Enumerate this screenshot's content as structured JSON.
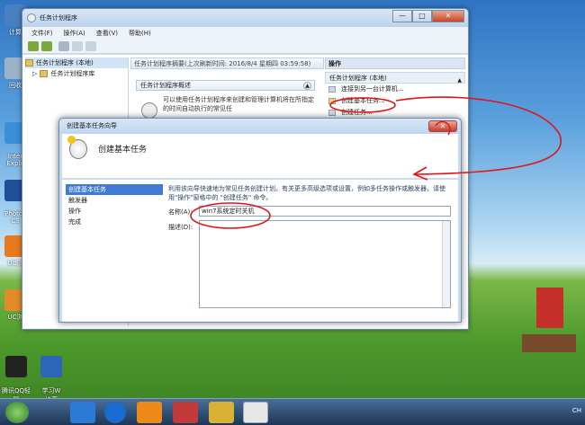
{
  "desktop": {
    "icons": [
      {
        "label": "计算",
        "color": "#4a7fc0"
      },
      {
        "label": "回收",
        "color": "#9bb3c9"
      },
      {
        "label": "Inter\nExplo",
        "color": "#3a8fd8"
      },
      {
        "label": "Photos\nCS",
        "color": "#1f4f99"
      },
      {
        "label": "UC浏",
        "color": "#e67a1c"
      },
      {
        "label": "UC浏",
        "color": "#e28b2a"
      },
      {
        "label": "腾讯QQ轻聊\n版",
        "color": "#222222"
      },
      {
        "label": "学习W\n格高",
        "color": "#2c66b8"
      }
    ]
  },
  "main_window": {
    "title": "任务计划程序",
    "min_btn": "—",
    "max_btn": "□",
    "close_btn": "✕",
    "menu": [
      "文件(F)",
      "操作(A)",
      "查看(V)",
      "帮助(H)"
    ],
    "tree": [
      {
        "label": "任务计划程序 (本地)",
        "selected": true
      },
      {
        "label": "任务计划程序库",
        "selected": false
      }
    ],
    "summary_header": "任务计划程序摘要(上次刷新时间: 2016/8/4 星期四 03:59:58)",
    "overview_section": "任务计划程序概述",
    "overview_text": "可以使用任务计划程序来创建和管理计算机将在所指定的时间自动执行的常见任",
    "actions_header": "操作",
    "actions_group": "任务计划程序 (本地)",
    "action_items": [
      "连接到另一台计算机...",
      "创建基本任务...",
      "创建任务..."
    ]
  },
  "wizard": {
    "title": "创建基本任务向导",
    "close_btn": "✕",
    "heading": "创建基本任务",
    "steps": [
      "创建基本任务",
      "触发器",
      "操作",
      "完成"
    ],
    "intro": "利用该向导快速地为常见任务创建计划。有关更多高级选项或设置，例如多任务操作或触发器，请使用\"操作\"窗格中的 \"创建任务\" 命令。",
    "name_label": "名称(A):",
    "name_value": "win7系统定时关机",
    "desc_label": "描述(D):",
    "desc_value": ""
  },
  "taskbar": {
    "tray_text": "CH",
    "apps": [
      {
        "name": "start-orb",
        "color": "#3f9b3a"
      },
      {
        "name": "internet-explorer",
        "color": "#2a7ad6"
      },
      {
        "name": "k-app",
        "color": "#1a6bd0"
      },
      {
        "name": "uc-browser",
        "color": "#ef8a1a"
      },
      {
        "name": "qq-game",
        "color": "#c23a3a"
      },
      {
        "name": "paint-tool",
        "color": "#d9b233"
      },
      {
        "name": "task-scheduler",
        "color": "#e7e7e7"
      }
    ]
  },
  "colors": {
    "annotation": "#e0151a",
    "selection": "#3d7bd5"
  }
}
